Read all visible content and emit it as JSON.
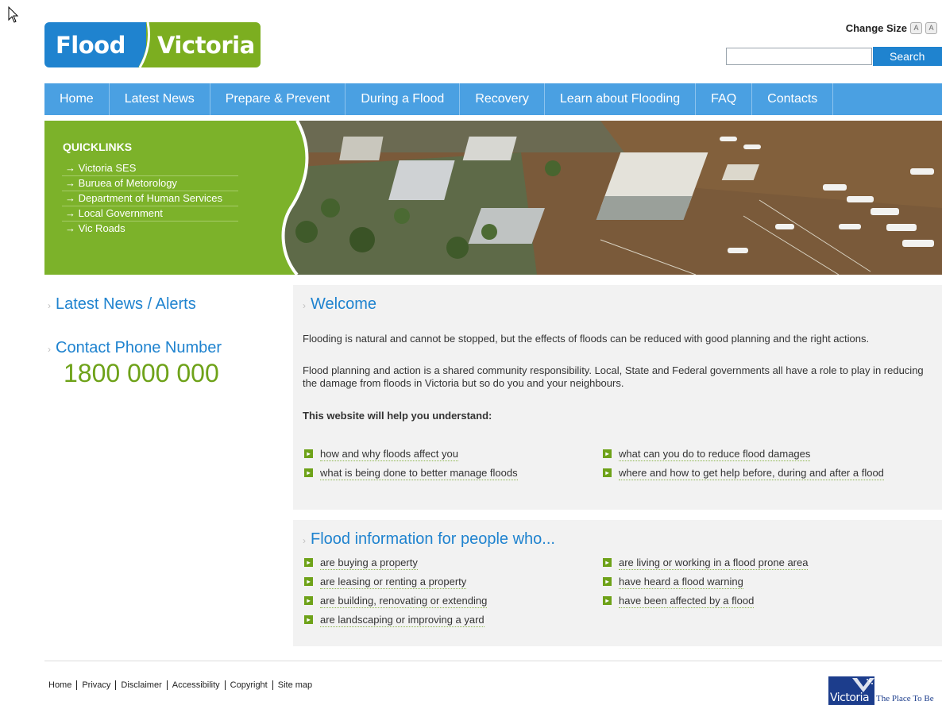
{
  "logo": {
    "word1": "Flood",
    "word2": "Victoria"
  },
  "header": {
    "change_size_label": "Change Size",
    "size_small": "A",
    "size_large": "A",
    "search_value": "",
    "search_button": "Search"
  },
  "nav": {
    "items": [
      "Home",
      "Latest News",
      "Prepare & Prevent",
      "During a Flood",
      "Recovery",
      "Learn about Flooding",
      "FAQ",
      "Contacts"
    ]
  },
  "quicklinks": {
    "title": "QUICKLINKS",
    "items": [
      "Victoria SES",
      "Buruea of Metorology",
      "Department of Human Services",
      "Local Government",
      "Vic Roads"
    ]
  },
  "sidebar": {
    "latest_news": "Latest News / Alerts",
    "contact_title": "Contact Phone Number",
    "phone": "1800 000 000"
  },
  "welcome": {
    "title": "Welcome",
    "p1": "Flooding is natural and cannot be stopped, but the effects of floods can be reduced with good planning and the right actions.",
    "p2": "Flood planning and action is a shared community responsibility. Local, State and Federal governments all have a role to play in reducing the damage from floods in Victoria but so do you and your neighbours.",
    "help_heading": "This website will help you understand:",
    "list_left": [
      "how and why floods affect you",
      "what is being done to better manage floods"
    ],
    "list_right": [
      "what can you do to reduce flood damages",
      "where and how to get help before, during and after a flood"
    ]
  },
  "flood_info": {
    "title": "Flood information for people who...",
    "list_left": [
      "are buying a property",
      "are leasing or renting a property",
      "are building, renovating or extending",
      "are landscaping or improving a yard"
    ],
    "list_right": [
      "are living or working in a flood prone area",
      "have heard a flood warning",
      "have been affected by a flood"
    ]
  },
  "footer": {
    "links": [
      "Home",
      "Privacy",
      "Disclaimer",
      "Accessibility",
      "Copyright",
      "Site map"
    ],
    "vic_logo_word": "Victoria",
    "vic_tagline": "The Place To Be"
  },
  "colors": {
    "brand_blue": "#1f83cf",
    "nav_blue": "#4aa0e2",
    "brand_green": "#7cb22a",
    "phone_green": "#6ea219"
  }
}
